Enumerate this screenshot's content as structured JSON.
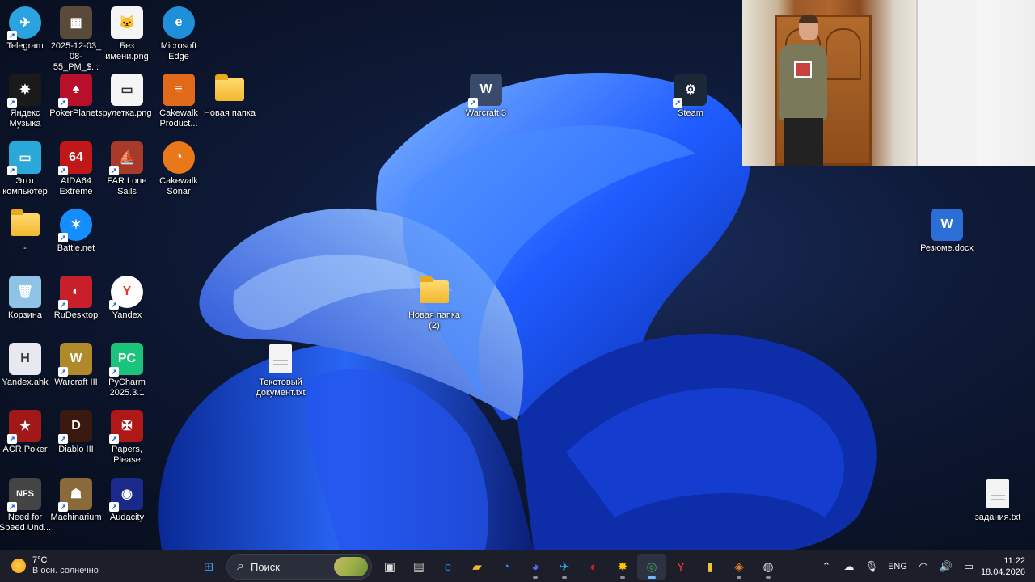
{
  "desktop_icons": [
    {
      "label": "Telegram",
      "icon": "telegram-icon",
      "color": "#2aa3e0",
      "glyph": "✈",
      "shortcut": true
    },
    {
      "label": "2025-12-03_\n08-55_PM_$...",
      "icon": "game-capture-icon",
      "color": "#5a4a3a",
      "glyph": "▦",
      "shortcut": false
    },
    {
      "label": "Без\nимени.png",
      "icon": "image-file-icon",
      "color": "#f5f5f5",
      "glyph": "🐱",
      "shortcut": false
    },
    {
      "label": "Microsoft\nEdge",
      "icon": "edge-icon",
      "color": "#1e8fd8",
      "glyph": "e",
      "shortcut": false
    },
    {
      "label": "Яндекс\nМузыка",
      "icon": "yandex-music-icon",
      "color": "#1a1a1a",
      "glyph": "✸",
      "shortcut": true
    },
    {
      "label": "PokerPlanets",
      "icon": "poker-planets-icon",
      "color": "#b8102a",
      "glyph": "♠",
      "shortcut": true
    },
    {
      "label": "рулетка.png",
      "icon": "image-file-icon",
      "color": "#f5f5f5",
      "glyph": "▭",
      "shortcut": false
    },
    {
      "label": "Cakewalk\nProduct...",
      "icon": "cakewalk-product-icon",
      "color": "#e06a1a",
      "glyph": "≡",
      "shortcut": false
    },
    {
      "label": "Новая папка",
      "icon": "folder-icon",
      "color": "#f2b82e",
      "glyph": "",
      "shortcut": false
    },
    {
      "label": "Warcraft 3",
      "icon": "warcraft-icon",
      "color": "#3a4a6a",
      "glyph": "W",
      "shortcut": true
    },
    {
      "label": "Steam",
      "icon": "steam-icon",
      "color": "#1b2838",
      "glyph": "⚙",
      "shortcut": true
    },
    {
      "label": "Этот\nкомпьютер",
      "icon": "this-pc-icon",
      "color": "#2aa8d8",
      "glyph": "▭",
      "shortcut": true
    },
    {
      "label": "AIDA64\nExtreme",
      "icon": "aida64-icon",
      "color": "#c01818",
      "glyph": "64",
      "shortcut": true
    },
    {
      "label": "FAR Lone\nSails",
      "icon": "far-lone-sails-icon",
      "color": "#a83a2a",
      "glyph": "⛵",
      "shortcut": true
    },
    {
      "label": "Cakewalk\nSonar",
      "icon": "cakewalk-sonar-icon",
      "color": "#e8781a",
      "glyph": "◔",
      "shortcut": false
    },
    {
      "label": "-",
      "icon": "folder-icon",
      "color": "#f2b82e",
      "glyph": "",
      "shortcut": false
    },
    {
      "label": "Battle.net",
      "icon": "battlenet-icon",
      "color": "#148eff",
      "glyph": "✶",
      "shortcut": true
    },
    {
      "label": "Резюме.docx",
      "icon": "word-document-icon",
      "color": "#2b6fd6",
      "glyph": "W",
      "shortcut": false
    },
    {
      "label": "Корзина",
      "icon": "recycle-bin-icon",
      "color": "#8fc3e6",
      "glyph": "🗑",
      "shortcut": false
    },
    {
      "label": "RuDesktop",
      "icon": "rudesktop-icon",
      "color": "#c8202a",
      "glyph": "◐",
      "shortcut": true
    },
    {
      "label": "Yandex",
      "icon": "yandex-browser-icon",
      "color": "#ffffff",
      "glyph": "Y",
      "shortcut": true
    },
    {
      "label": "Новая папка\n(2)",
      "icon": "folder-icon",
      "color": "#f2b82e",
      "glyph": "",
      "shortcut": false
    },
    {
      "label": "Yandex.ahk",
      "icon": "ahk-script-icon",
      "color": "#e8e8f0",
      "glyph": "H",
      "shortcut": false
    },
    {
      "label": "Warcraft III",
      "icon": "warcraft-iii-icon",
      "color": "#b08a2a",
      "glyph": "W",
      "shortcut": true
    },
    {
      "label": "PyCharm\n2025.3.1",
      "icon": "pycharm-icon",
      "color": "#1ac47a",
      "glyph": "PC",
      "shortcut": true
    },
    {
      "label": "Текстовый\nдокумент.txt",
      "icon": "text-file-icon",
      "color": "#f3f3f3",
      "glyph": "",
      "shortcut": false
    },
    {
      "label": "ACR Poker",
      "icon": "acr-poker-icon",
      "color": "#a01818",
      "glyph": "★",
      "shortcut": true
    },
    {
      "label": "Diablo III",
      "icon": "diablo-iii-icon",
      "color": "#3a1a10",
      "glyph": "D",
      "shortcut": true
    },
    {
      "label": "Papers,\nPlease",
      "icon": "papers-please-icon",
      "color": "#b01818",
      "glyph": "✠",
      "shortcut": true
    },
    {
      "label": "Need for\nSpeed Und...",
      "icon": "nfs-icon",
      "color": "#444444",
      "glyph": "NFS",
      "shortcut": true
    },
    {
      "label": "Machinarium",
      "icon": "machinarium-icon",
      "color": "#8a6a3a",
      "glyph": "☗",
      "shortcut": true
    },
    {
      "label": "Audacity",
      "icon": "audacity-icon",
      "color": "#1a2a8a",
      "glyph": "◉",
      "shortcut": true
    },
    {
      "label": "задания.txt",
      "icon": "text-file-icon",
      "color": "#f3f3f3",
      "glyph": "",
      "shortcut": false
    }
  ],
  "taskbar": {
    "weather": {
      "temperature": "7°C",
      "condition": "В осн. солнечно"
    },
    "search_label": "Поиск",
    "apps": [
      {
        "icon": "windows-start-icon",
        "glyph": "⊞",
        "color": "#3aa0ff",
        "active": false,
        "running": false
      },
      {
        "icon": "search-icon",
        "glyph": "",
        "color": "#fff",
        "active": false,
        "running": false
      },
      {
        "icon": "task-view-icon",
        "glyph": "▣",
        "color": "#ddd",
        "active": false,
        "running": false
      },
      {
        "icon": "nfs-taskbar-icon",
        "glyph": "▤",
        "color": "#bbb",
        "active": false,
        "running": false
      },
      {
        "icon": "edge-icon",
        "glyph": "e",
        "color": "#1e8fd8",
        "active": false,
        "running": false
      },
      {
        "icon": "file-explorer-icon",
        "glyph": "▰",
        "color": "#f2b82e",
        "active": false,
        "running": false
      },
      {
        "icon": "cortana-icon",
        "glyph": "◔",
        "color": "#2a8aff",
        "active": false,
        "running": false
      },
      {
        "icon": "discord-icon",
        "glyph": "◕",
        "color": "#5865f2",
        "active": false,
        "running": true
      },
      {
        "icon": "telegram-icon",
        "glyph": "✈",
        "color": "#2aa3e0",
        "active": false,
        "running": true
      },
      {
        "icon": "rudesktop-icon",
        "glyph": "◐",
        "color": "#c8202a",
        "active": false,
        "running": false
      },
      {
        "icon": "yandex-music-icon",
        "glyph": "✸",
        "color": "#ffcc00",
        "active": false,
        "running": true
      },
      {
        "icon": "chrome-icon",
        "glyph": "◎",
        "color": "#34a853",
        "active": true,
        "running": true
      },
      {
        "icon": "yandex-browser-icon",
        "glyph": "Y",
        "color": "#ff3333",
        "active": false,
        "running": false
      },
      {
        "icon": "notes-icon",
        "glyph": "▮",
        "color": "#f2c22e",
        "active": false,
        "running": false
      },
      {
        "icon": "recorder-icon",
        "glyph": "◈",
        "color": "#e07a2a",
        "active": false,
        "running": true
      },
      {
        "icon": "obs-icon",
        "glyph": "◍",
        "color": "#dddddd",
        "active": false,
        "running": true
      }
    ],
    "tray": {
      "language": "ENG",
      "time": "11:22",
      "date": "18.04.2026"
    }
  }
}
